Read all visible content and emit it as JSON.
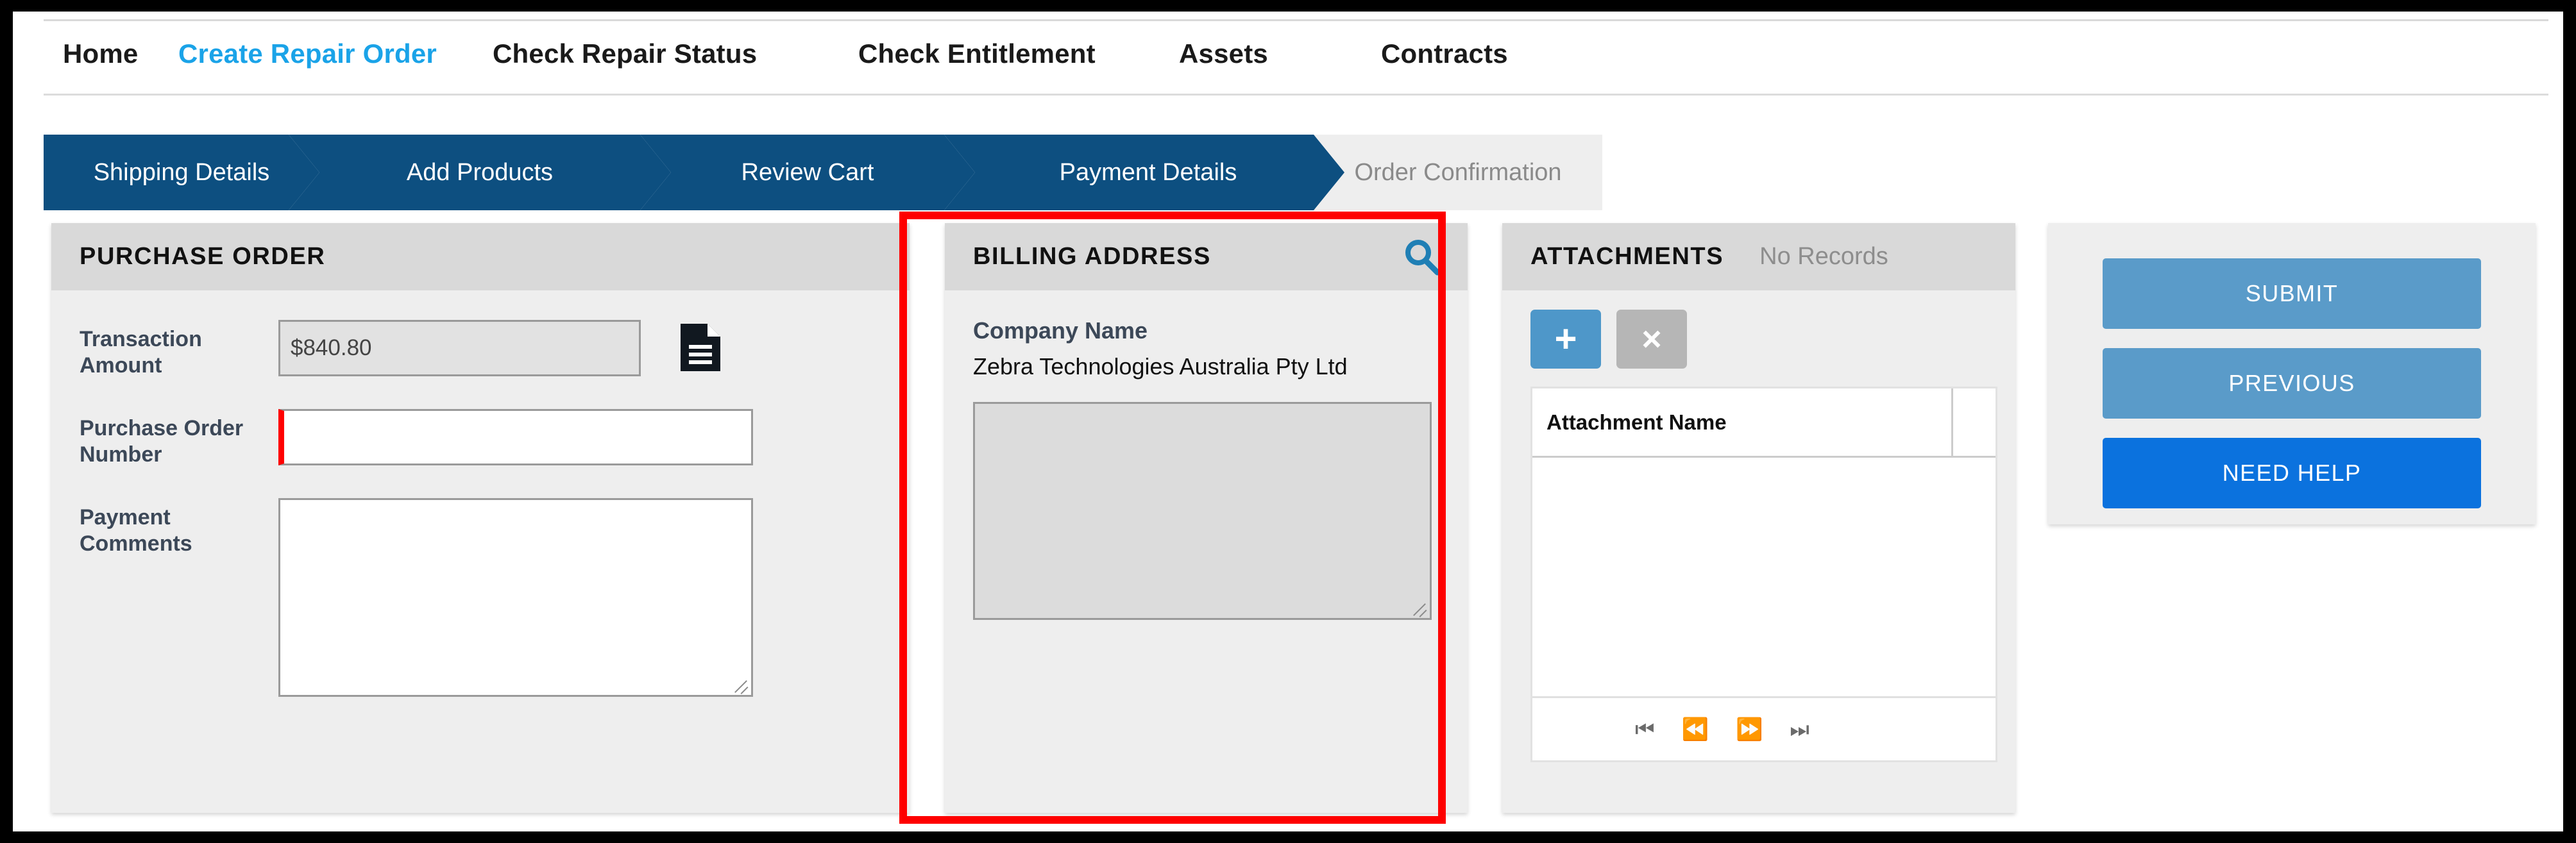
{
  "nav": {
    "tabs": [
      {
        "label": "Home",
        "active": false
      },
      {
        "label": "Create Repair Order",
        "active": true
      },
      {
        "label": "Check Repair Status",
        "active": false
      },
      {
        "label": "Check Entitlement",
        "active": false
      },
      {
        "label": "Assets",
        "active": false
      },
      {
        "label": "Contracts",
        "active": false
      }
    ]
  },
  "steps": [
    {
      "label": "Shipping Details",
      "state": "done"
    },
    {
      "label": "Add Products",
      "state": "done"
    },
    {
      "label": "Review Cart",
      "state": "done"
    },
    {
      "label": "Payment Details",
      "state": "done"
    },
    {
      "label": "Order Confirmation",
      "state": "pending"
    }
  ],
  "purchase_order": {
    "title": "PURCHASE ORDER",
    "transaction_amount_label": "Transaction Amount",
    "transaction_amount_value": "$840.80",
    "po_number_label": "Purchase Order Number",
    "po_number_value": "",
    "po_number_placeholder": "",
    "payment_comments_label": "Payment Comments",
    "payment_comments_value": "",
    "payment_comments_placeholder": "",
    "document_icon": "document-icon"
  },
  "billing_address": {
    "title": "BILLING ADDRESS",
    "search_icon": "search-icon",
    "company_name_label": "Company Name",
    "company_name_value": "Zebra Technologies Australia Pty Ltd",
    "address_value": "",
    "address_placeholder": ""
  },
  "attachments": {
    "title": "ATTACHMENTS",
    "status": "No Records",
    "add_label": "+",
    "delete_label": "×",
    "column_name": "Attachment Name",
    "rows": [],
    "pager": [
      {
        "name": "first-page",
        "glyph": "⏮"
      },
      {
        "name": "previous-page",
        "glyph": "⏪"
      },
      {
        "name": "next-page",
        "glyph": "⏩"
      },
      {
        "name": "last-page",
        "glyph": "⏭"
      }
    ]
  },
  "actions": {
    "submit_label": "SUBMIT",
    "previous_label": "PREVIOUS",
    "help_label": "NEED HELP"
  },
  "colors": {
    "accent_blue": "#1aa3e8",
    "step_done": "#0d4f80",
    "step_pending": "#eeeeee",
    "button_secondary": "#5a9bc9",
    "button_primary": "#0b72de",
    "required_marker": "#ff0000",
    "highlight_box": "#fe0000",
    "attach_add": "#4e97c9",
    "attach_delete": "#b6b6b6",
    "search_icon": "#1f7fb5"
  }
}
